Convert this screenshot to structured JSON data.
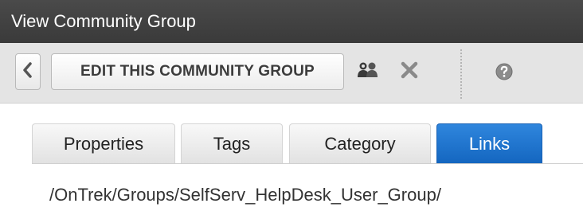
{
  "window": {
    "title": "View Community Group"
  },
  "toolbar": {
    "back_icon": "chevron-left-icon",
    "edit_label": "EDIT THIS COMMUNITY GROUP",
    "members_icon": "group-members-icon",
    "delete_icon": "close-x-icon",
    "help_icon": "help-question-icon"
  },
  "tabs": [
    {
      "label": "Properties",
      "active": false
    },
    {
      "label": "Tags",
      "active": false
    },
    {
      "label": "Category",
      "active": false
    },
    {
      "label": "Links",
      "active": true
    }
  ],
  "links": {
    "path": "/OnTrek/Groups/SelfServ_HelpDesk_User_Group/"
  },
  "colors": {
    "titlebar": "#3f3f3f",
    "toolbar": "#e4e4e4",
    "active_tab": "#1e73cf"
  }
}
